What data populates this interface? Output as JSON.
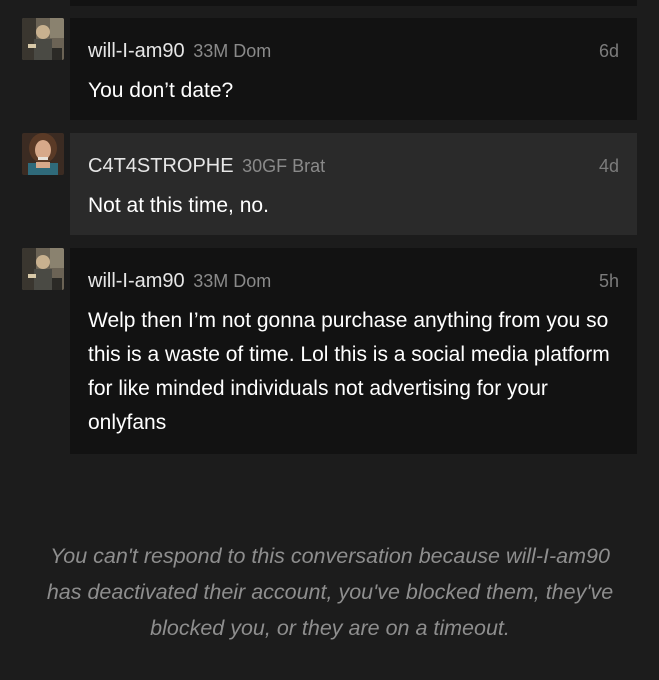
{
  "messages": [
    {
      "username": "will-I-am90",
      "userinfo": "33M Dom",
      "time": "6d",
      "text": "You don’t date?",
      "avatar": "male-avatar-icon",
      "side": "them"
    },
    {
      "username": "C4T4STROPHE",
      "userinfo": "30GF Brat",
      "time": "4d",
      "text": "Not at this time, no.",
      "avatar": "female-avatar-icon",
      "side": "me"
    },
    {
      "username": "will-I-am90",
      "userinfo": "33M Dom",
      "time": "5h",
      "text": "Welp then I’m not gonna purchase anything from you so this is a waste of time. Lol this is a social media platform for like minded individuals not advertising for your onlyfans",
      "avatar": "male-avatar-icon",
      "side": "them"
    }
  ],
  "notice": "You can't respond to this conversation because will-I-am90 has deactivated their account, you've blocked them, they've blocked you, or they are on a timeout.",
  "colors": {
    "background": "#1c1c1c",
    "bubble_them": "#121212",
    "bubble_me": "#2a2a2a",
    "meta_text": "#8a8a8a",
    "notice_text": "#8e8e8e"
  }
}
